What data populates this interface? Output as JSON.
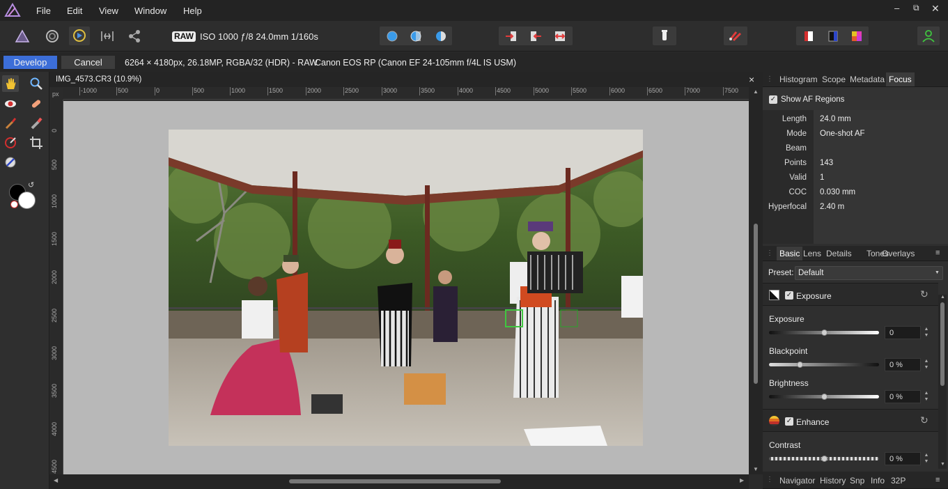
{
  "menu": {
    "items": [
      "File",
      "Edit",
      "View",
      "Window",
      "Help"
    ]
  },
  "toolbar": {
    "raw_badge": "RAW",
    "exposure_info": "ISO 1000 ƒ/8 24.0mm 1/160s"
  },
  "context": {
    "develop_label": "Develop",
    "cancel_label": "Cancel",
    "image_info": "6264 × 4180px, 26.18MP, RGBA/32 (HDR) - RAW",
    "camera_info": "Canon EOS RP (Canon EF 24-105mm f/4L IS USM)"
  },
  "document": {
    "tab_title": "IMG_4573.CR3 (10.9%)",
    "close_glyph": "×"
  },
  "rulers": {
    "unit": "px",
    "h_ticks": [
      "-1000",
      "500",
      "0",
      "500",
      "1000",
      "1500",
      "2000",
      "2500",
      "3000",
      "3500",
      "4000",
      "4500",
      "5000",
      "5500",
      "6000",
      "6500",
      "7000",
      "7500"
    ],
    "v_ticks": [
      "0",
      "500",
      "1000",
      "1500",
      "2000",
      "2500",
      "3000",
      "3500",
      "4000",
      "4500"
    ]
  },
  "focus_panel": {
    "tabs": [
      "Histogram",
      "Scope",
      "Metadata",
      "Focus"
    ],
    "selected_tab": "Focus",
    "show_af_label": "Show AF Regions",
    "rows": [
      {
        "label": "Length",
        "value": "24.0 mm"
      },
      {
        "label": "Mode",
        "value": "One-shot AF"
      },
      {
        "label": "Beam",
        "value": ""
      },
      {
        "label": "Points",
        "value": "143"
      },
      {
        "label": "Valid",
        "value": "1"
      },
      {
        "label": "COC",
        "value": "0.030 mm"
      },
      {
        "label": "Hyperfocal",
        "value": "2.40 m"
      }
    ]
  },
  "adjust_panel": {
    "tabs": [
      "Basic",
      "Lens",
      "Details",
      "Tones",
      "Overlays"
    ],
    "selected_tab": "Basic",
    "preset_label": "Preset:",
    "preset_value": "Default",
    "exposure_section": "Exposure",
    "exposure": {
      "label": "Exposure",
      "value": "0",
      "level": 0.5
    },
    "blackpoint": {
      "label": "Blackpoint",
      "value": "0 %",
      "level": 0.28
    },
    "brightness": {
      "label": "Brightness",
      "value": "0 %",
      "level": 0.5
    },
    "enhance_section": "Enhance",
    "contrast": {
      "label": "Contrast",
      "value": "0 %",
      "level": 0.5
    }
  },
  "bottom_panel": {
    "tabs": [
      "Navigator",
      "History",
      "Snp",
      "Info",
      "32P"
    ]
  },
  "colors": {
    "accent": "#3c6ed8",
    "panel": "#2f2f2f",
    "canvas": "#b8b8b8",
    "af_box": "#3fc63f"
  }
}
